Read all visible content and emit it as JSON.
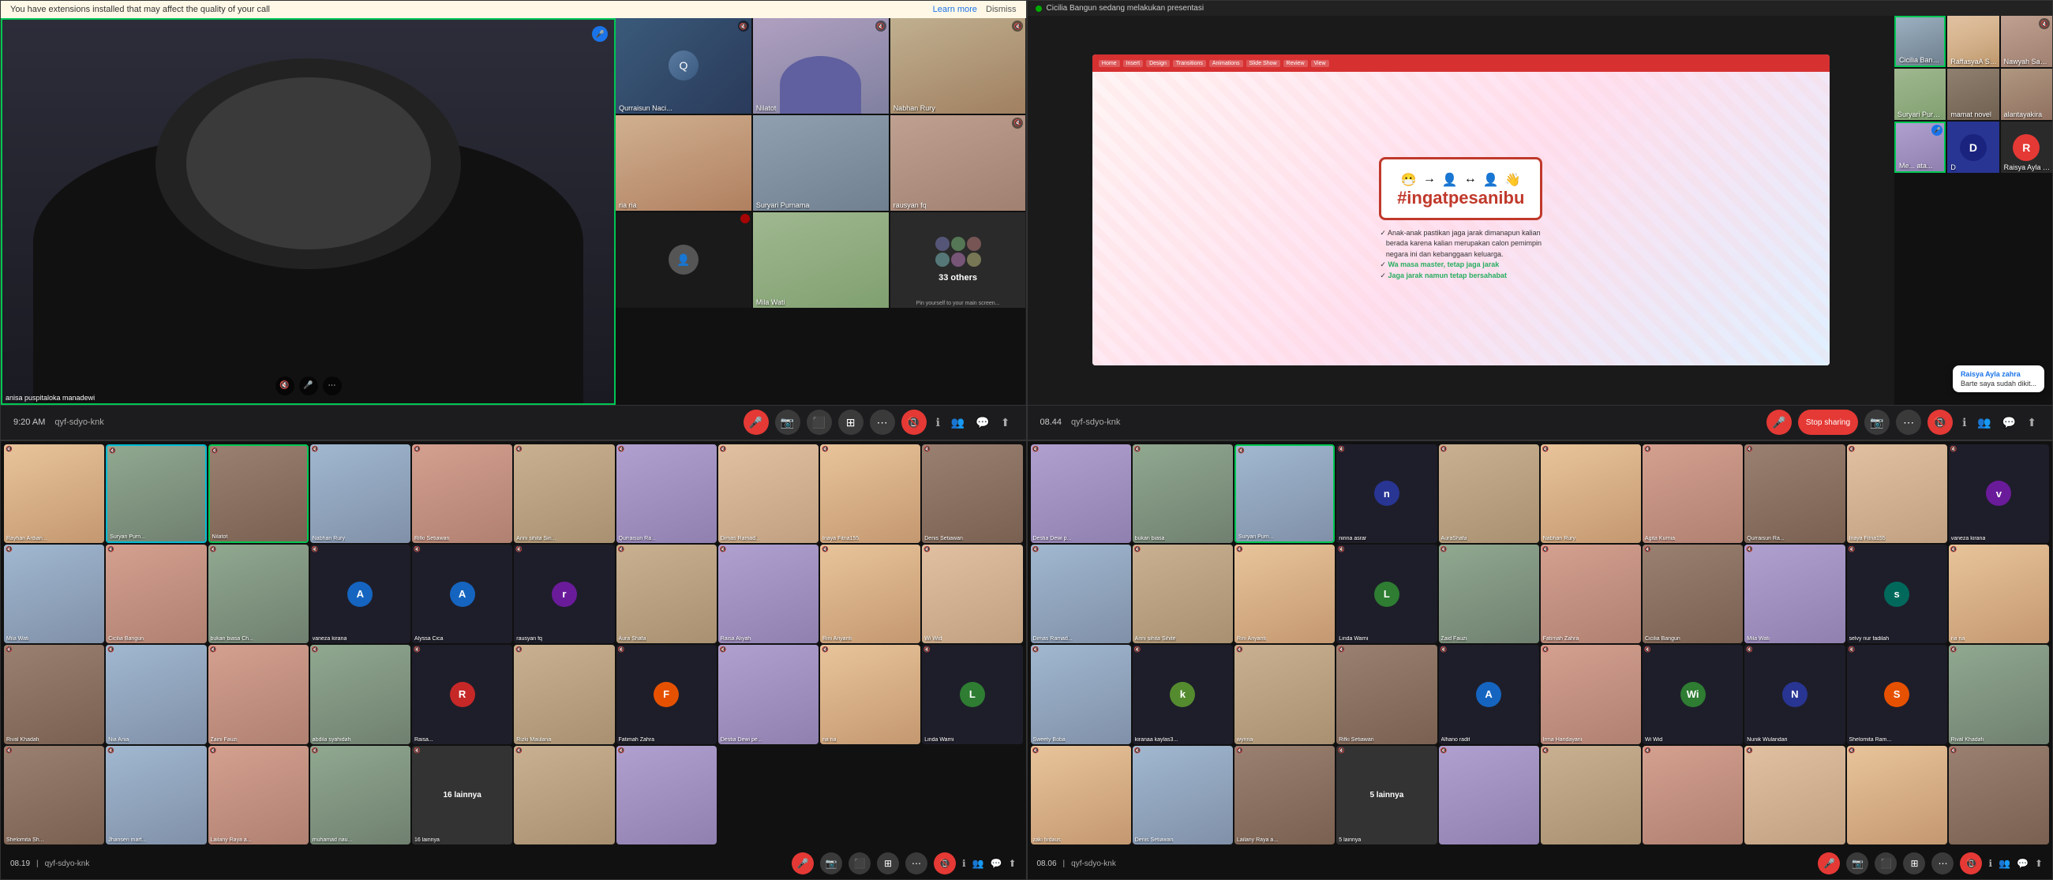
{
  "q1": {
    "banner": {
      "text": "You have extensions installed that may affect the quality of your call",
      "learn_more": "Learn more",
      "dismiss": "Dismiss"
    },
    "main_speaker": {
      "name": "anisa puspitaloka manadewi"
    },
    "side_participants": [
      {
        "name": "Qurraisun Naci...",
        "bg": "thumb-bg-1",
        "mic_off": true
      },
      {
        "name": "Nilatot",
        "bg": "thumb-bg-2",
        "mic_off": true
      },
      {
        "name": "Nabhan Rury",
        "bg": "thumb-bg-3",
        "mic_off": true
      },
      {
        "name": "ria ria",
        "bg": "thumb-bg-4",
        "mic_off": false
      },
      {
        "name": "Suryari Purnama",
        "bg": "thumb-bg-5",
        "mic_off": false
      },
      {
        "name": "rausyan fq",
        "bg": "thumb-bg-6",
        "mic_off": true
      },
      {
        "name": "",
        "bg": "thumb-bg-dark",
        "mic_off": false
      },
      {
        "name": "Mila Wati",
        "bg": "thumb-bg-7",
        "mic_off": false
      },
      {
        "name": "33 others",
        "bg": "thumb-bg-dark",
        "is_others": true
      }
    ],
    "toolbar": {
      "time": "9:20 AM",
      "meeting_id": "qyf-sdyo-knk"
    }
  },
  "q2": {
    "presenter_bar": "Cicilia Bangun sedang melakukan presentasi",
    "slide": {
      "hashtag": "#ingatpesanibu",
      "bullets": [
        "Anak-anak pastikan jaga jarak dimanapun kalian",
        "berada karena kalian merupakan calon pemimpin",
        "negara ini dan kebanggaan keluarga.",
        "Wa masa master, tetap jaga jarak",
        "Jaga jarak namun tetap bersahabat"
      ]
    },
    "right_participants": [
      {
        "name": "Cicilia Bangun",
        "bg": "photo-3",
        "active": true
      },
      {
        "name": "RaffasyaA Shafw...",
        "bg": "photo-1"
      },
      {
        "name": "Nawyah Sayuti",
        "bg": "photo-4"
      },
      {
        "name": "Suryari Purnama",
        "bg": "photo-5"
      },
      {
        "name": "mamat novel",
        "bg": "photo-2"
      },
      {
        "name": "alantayakira",
        "bg": "photo-6"
      },
      {
        "name": "Me... ata...",
        "bg": "photo-7",
        "active": true
      },
      {
        "name": "D",
        "bg": "av-indigo"
      },
      {
        "name": "Raisya Ayla zahra",
        "chat_bubble": true
      }
    ],
    "chat_bubble": {
      "name": "Raisya Ayla zahra",
      "text": "Barte saya sudah dikit..."
    },
    "toolbar": {
      "time": "08.44",
      "meeting_id": "qyf-sdyo-knk"
    }
  },
  "q3": {
    "participants": [
      {
        "name": "Rayhan Ardian...",
        "type": "photo",
        "bg": "photo-1"
      },
      {
        "name": "Suryari Purn...",
        "type": "photo",
        "bg": "photo-5",
        "speaking": true
      },
      {
        "name": "Nilatot",
        "type": "photo",
        "bg": "photo-2",
        "active": true
      },
      {
        "name": "Nabhan Rury",
        "type": "photo",
        "bg": "photo-3"
      },
      {
        "name": "Rifki Setiawan",
        "type": "photo",
        "bg": "photo-4"
      },
      {
        "name": "Anni sihita Sin...",
        "type": "photo",
        "bg": "photo-6"
      },
      {
        "name": "Qurraisun Ra...",
        "type": "photo",
        "bg": "photo-7"
      },
      {
        "name": "Dimas Ramad...",
        "type": "photo",
        "bg": "photo-8"
      },
      {
        "name": "Inaya Fitria155",
        "type": "photo",
        "bg": "photo-1"
      },
      {
        "name": "Denis Setiawan",
        "type": "photo",
        "bg": "photo-2"
      },
      {
        "name": "Mila Wati",
        "type": "photo",
        "bg": "photo-3"
      },
      {
        "name": "Cicilia Bangun",
        "type": "photo",
        "bg": "photo-4"
      },
      {
        "name": "bukan biasa Ch...",
        "type": "photo",
        "bg": "photo-5"
      },
      {
        "name": "vaneza kirana",
        "type": "avatar",
        "initial": "A",
        "color": "av-blue"
      },
      {
        "name": "Alyssa Cica",
        "type": "avatar",
        "initial": "A",
        "color": "av-blue"
      },
      {
        "name": "rausyan fq",
        "type": "avatar",
        "initial": "r",
        "color": "av-purple"
      },
      {
        "name": "Aura Shafa",
        "type": "photo",
        "bg": "photo-6"
      },
      {
        "name": "Raisa Aliyah",
        "type": "photo",
        "bg": "photo-7"
      },
      {
        "name": "Rini Ariyanti",
        "type": "photo",
        "bg": "photo-1"
      },
      {
        "name": "Wi Wid",
        "type": "photo",
        "bg": "photo-8"
      },
      {
        "name": "Rival Khadafi",
        "type": "photo",
        "bg": "photo-2"
      },
      {
        "name": "Nia Ania",
        "type": "photo",
        "bg": "photo-3"
      },
      {
        "name": "Zaini Fauzi",
        "type": "photo",
        "bg": "photo-4"
      },
      {
        "name": "abdila syahidah",
        "type": "photo",
        "bg": "photo-5"
      },
      {
        "name": "Raisa...",
        "type": "avatar",
        "initial": "R",
        "color": "av-red"
      },
      {
        "name": "Rizki Maulana",
        "type": "photo",
        "bg": "photo-6"
      },
      {
        "name": "Fatimah Zahra",
        "type": "avatar",
        "initial": "F",
        "color": "av-orange"
      },
      {
        "name": "Destia Dewi pe...",
        "type": "photo",
        "bg": "photo-7"
      },
      {
        "name": "ria ria",
        "type": "photo",
        "bg": "photo-1"
      },
      {
        "name": "Linda Warni",
        "type": "avatar",
        "initial": "L",
        "color": "av-green"
      },
      {
        "name": "Shelomita Sh...",
        "type": "photo",
        "bg": "photo-2"
      },
      {
        "name": "Jhansen mart...",
        "type": "photo",
        "bg": "photo-3"
      },
      {
        "name": "Lailany Raya a...",
        "type": "photo",
        "bg": "photo-4"
      },
      {
        "name": "muhamad nau...",
        "type": "photo",
        "bg": "photo-5"
      },
      {
        "name": "16 lainnya",
        "type": "more",
        "count": "16 lainnya"
      },
      {
        "name": "",
        "type": "photo",
        "bg": "photo-6"
      },
      {
        "name": "",
        "type": "photo",
        "bg": "photo-7"
      }
    ],
    "toolbar": {
      "time": "08.19",
      "meeting_id": "qyf-sdyo-knk"
    }
  },
  "q4": {
    "participants": [
      {
        "name": "Destia Dewi p...",
        "type": "photo",
        "bg": "photo-7"
      },
      {
        "name": "bukan biasa",
        "type": "photo",
        "bg": "photo-5"
      },
      {
        "name": "Suryari Purn...",
        "type": "photo",
        "bg": "photo-3",
        "active": true
      },
      {
        "name": "nirina asrar",
        "type": "avatar",
        "initial": "n",
        "color": "av-indigo"
      },
      {
        "name": "AuraShafa",
        "type": "photo",
        "bg": "photo-6"
      },
      {
        "name": "Nabhan Rury",
        "type": "photo",
        "bg": "photo-1"
      },
      {
        "name": "Agita Kurnia",
        "type": "photo",
        "bg": "photo-4"
      },
      {
        "name": "Qurraisun Ra...",
        "type": "photo",
        "bg": "photo-2"
      },
      {
        "name": "Inaya Fitria155",
        "type": "photo",
        "bg": "photo-8"
      },
      {
        "name": "vaneza kirana",
        "type": "avatar",
        "initial": "v",
        "color": "av-purple"
      },
      {
        "name": "Dimas Ramad...",
        "type": "photo",
        "bg": "photo-3"
      },
      {
        "name": "Anni sihita Sihite",
        "type": "photo",
        "bg": "photo-6"
      },
      {
        "name": "Rini Ariyanti",
        "type": "photo",
        "bg": "photo-1"
      },
      {
        "name": "Linda Warni",
        "type": "avatar",
        "initial": "L",
        "color": "av-green"
      },
      {
        "name": "Zaid Fauzi",
        "type": "photo",
        "bg": "photo-5"
      },
      {
        "name": "Fatimah Zahra",
        "type": "photo",
        "bg": "photo-4"
      },
      {
        "name": "Cicilia Bangun",
        "type": "photo",
        "bg": "photo-2"
      },
      {
        "name": "Mila Wati",
        "type": "photo",
        "bg": "photo-7"
      },
      {
        "name": "selvy nur fadilah",
        "type": "avatar",
        "initial": "s",
        "color": "av-teal"
      },
      {
        "name": "ria ria",
        "type": "photo",
        "bg": "photo-1"
      },
      {
        "name": "Sweety Boba",
        "type": "photo",
        "bg": "photo-3"
      },
      {
        "name": "kiranaa kaylas3...",
        "type": "avatar",
        "initial": "k",
        "color": "av-lime"
      },
      {
        "name": "wynna",
        "type": "photo",
        "bg": "photo-6"
      },
      {
        "name": "Rifki Setiawan",
        "type": "photo",
        "bg": "photo-2"
      },
      {
        "name": "Alfiano radit",
        "type": "avatar",
        "initial": "A",
        "color": "av-blue"
      },
      {
        "name": "Irma Handayani",
        "type": "photo",
        "bg": "photo-4"
      },
      {
        "name": "Wi Wid",
        "type": "avatar",
        "initial": "Wi",
        "color": "av-green"
      },
      {
        "name": "Nunik Wulandari",
        "type": "avatar",
        "initial": "N",
        "color": "av-indigo"
      },
      {
        "name": "Shelomita Ram...",
        "type": "avatar",
        "initial": "S",
        "color": "av-orange"
      },
      {
        "name": "Rival Khadafi",
        "type": "photo",
        "bg": "photo-5"
      },
      {
        "name": "zaki firdaus",
        "type": "photo",
        "bg": "photo-1"
      },
      {
        "name": "Denis Setiawan",
        "type": "photo",
        "bg": "photo-3"
      },
      {
        "name": "Lailany Raya a...",
        "type": "photo",
        "bg": "photo-2"
      },
      {
        "name": "5 lainnya",
        "type": "more",
        "count": "5 lainnya"
      },
      {
        "name": "",
        "type": "photo",
        "bg": "photo-7"
      },
      {
        "name": "",
        "type": "photo",
        "bg": "photo-6"
      },
      {
        "name": "",
        "type": "photo",
        "bg": "photo-4"
      },
      {
        "name": "",
        "type": "photo",
        "bg": "photo-8"
      },
      {
        "name": "",
        "type": "photo",
        "bg": "photo-1"
      },
      {
        "name": "",
        "type": "photo",
        "bg": "photo-2"
      }
    ],
    "toolbar": {
      "time": "08.06",
      "meeting_id": "qyf-sdyo-knk"
    }
  },
  "icons": {
    "mic": "🎤",
    "mic_off": "🔇",
    "camera": "📷",
    "phone_off": "📵",
    "more": "⋯",
    "people": "👥",
    "chat": "💬",
    "share": "⬆",
    "info": "ℹ",
    "grid": "⊞",
    "settings": "⚙"
  }
}
